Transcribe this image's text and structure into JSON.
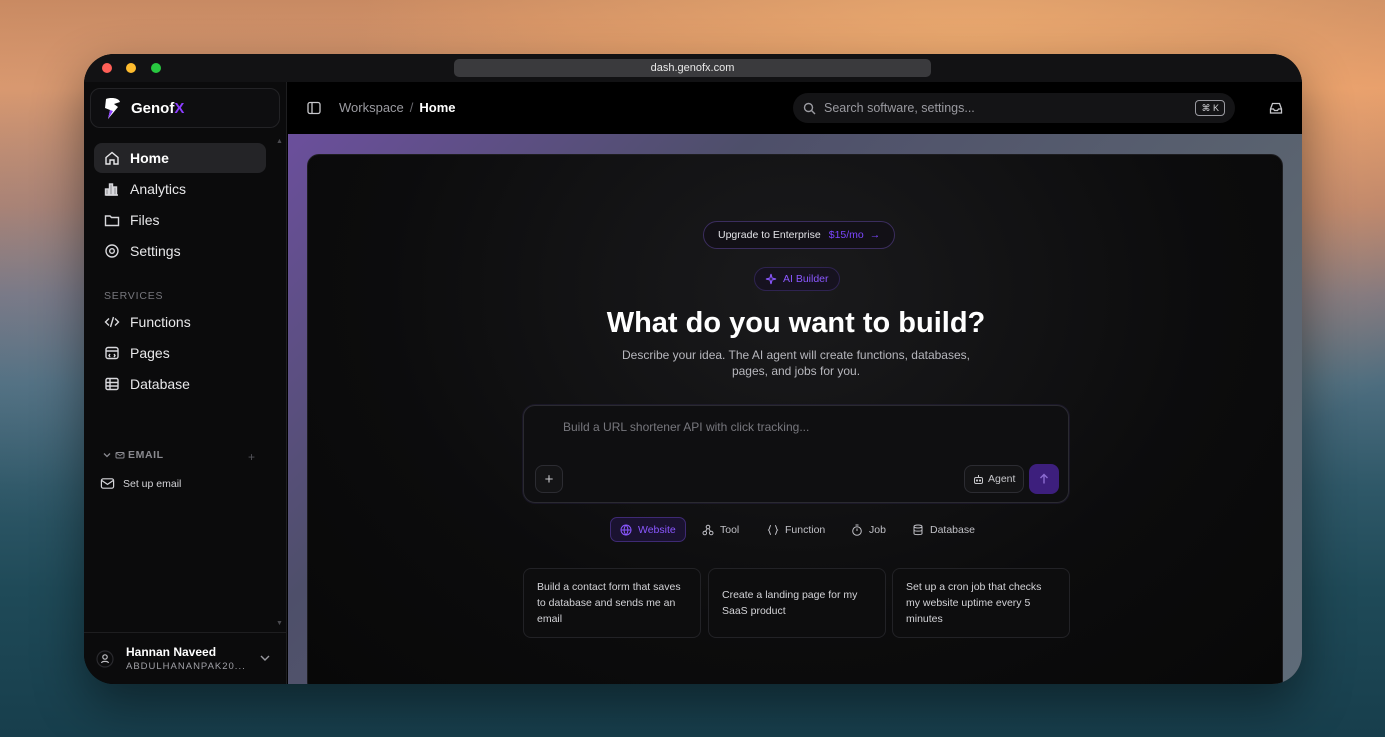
{
  "browser": {
    "url": "dash.genofx.com"
  },
  "brand": {
    "name": "Genof",
    "accent": "X",
    "accent_color": "#8b3dff"
  },
  "sidebar": {
    "items": [
      {
        "label": "Home",
        "icon": "home-icon",
        "active": true
      },
      {
        "label": "Analytics",
        "icon": "bar-chart-icon"
      },
      {
        "label": "Files",
        "icon": "folder-icon"
      },
      {
        "label": "Settings",
        "icon": "gear-icon"
      }
    ],
    "services_label": "SERVICES",
    "services": [
      {
        "label": "Functions",
        "icon": "code-icon"
      },
      {
        "label": "Pages",
        "icon": "browser-window-icon"
      },
      {
        "label": "Database",
        "icon": "table-icon"
      }
    ],
    "email_label": "EMAIL",
    "setup_email": "Set up email"
  },
  "user": {
    "name": "Hannan Naveed",
    "email": "ABDULHANANPAK20..."
  },
  "topbar": {
    "breadcrumb": {
      "parent": "Workspace",
      "separator": "/",
      "current": "Home"
    },
    "search_placeholder": "Search software, settings...",
    "shortcut": "⌘ K"
  },
  "hero": {
    "upgrade_label": "Upgrade to Enterprise",
    "upgrade_price": "$15/mo",
    "upgrade_arrow": "→",
    "badge": "AI Builder",
    "title": "What do you want to build?",
    "subtitle": "Describe your idea. The AI agent will create functions, databases, pages, and jobs for you."
  },
  "prompt": {
    "placeholder": "Build a URL shortener API with click tracking...",
    "attach_label": "+",
    "agent_label": "Agent"
  },
  "types": [
    {
      "label": "Website",
      "icon": "globe-icon",
      "active": true
    },
    {
      "label": "Tool",
      "icon": "tool-icon"
    },
    {
      "label": "Function",
      "icon": "braces-icon"
    },
    {
      "label": "Job",
      "icon": "timer-icon"
    },
    {
      "label": "Database",
      "icon": "database-icon"
    }
  ],
  "suggestions": [
    "Build a contact form that saves to database and sends me an email",
    "Create a landing page for my SaaS product",
    "Set up a cron job that checks my website uptime every 5 minutes"
  ],
  "colors": {
    "accent": "#8b3dff",
    "send": "#3d1f7d"
  }
}
